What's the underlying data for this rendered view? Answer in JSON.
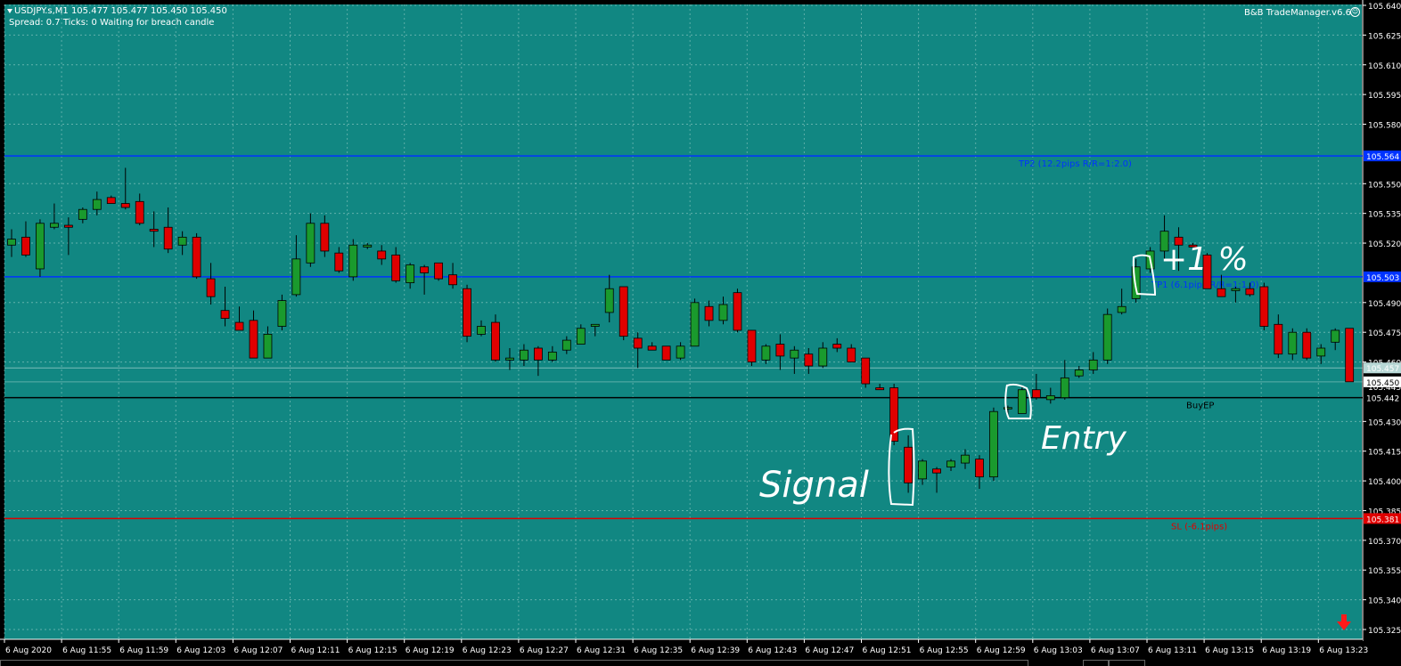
{
  "header": {
    "symbol_line": "USDJPY.s,M1  105.477 105.477 105.450 105.450",
    "status_line": "Spread: 0.7  Ticks: 0  Waiting for breach candle",
    "trade_manager": "B&B TradeManager.v6.6"
  },
  "colors": {
    "background": "#118782",
    "grid": "#a6d6cf",
    "bull": "#1a9a2d",
    "bear": "#e00000",
    "candle_outline": "#000000",
    "tp_line": "#0033ff",
    "ep_line": "#000000",
    "sl_line": "#e00000",
    "annotation": "#ffffff"
  },
  "price_axis": {
    "labels": [
      "105.640",
      "105.625",
      "105.610",
      "105.595",
      "105.580",
      "105.550",
      "105.535",
      "105.520",
      "105.490",
      "105.475",
      "105.460",
      "105.430",
      "105.415",
      "105.400",
      "105.385",
      "105.370",
      "105.355",
      "105.340",
      "105.325"
    ],
    "tags": [
      {
        "name": "tp2-price-tag",
        "text": "105.564",
        "color": "#0033ff",
        "text_color": "#ffffff",
        "price": 105.564
      },
      {
        "name": "tp1-price-tag",
        "text": "105.503",
        "color": "#0033ff",
        "text_color": "#ffffff",
        "price": 105.503
      },
      {
        "name": "ask-price-tag",
        "text": "105.457",
        "color": "#b8d8d6",
        "text_color": "#ffffff",
        "price": 105.457
      },
      {
        "name": "bid-price-tag",
        "text": "105.450",
        "color": "#ffffff",
        "text_color": "#000000",
        "price": 105.45
      },
      {
        "name": "ep-price-tag",
        "text": "105.442",
        "color": "#000000",
        "text_color": "#ffffff",
        "price": 105.442
      },
      {
        "name": "sl-price-tag",
        "text": "105.381",
        "color": "#e00000",
        "text_color": "#ffffff",
        "price": 105.381
      }
    ],
    "partial_label": "105.445"
  },
  "time_axis": {
    "labels": [
      "6 Aug 2020",
      "6 Aug 11:55",
      "6 Aug 11:59",
      "6 Aug 12:03",
      "6 Aug 12:07",
      "6 Aug 12:11",
      "6 Aug 12:15",
      "6 Aug 12:19",
      "6 Aug 12:23",
      "6 Aug 12:27",
      "6 Aug 12:31",
      "6 Aug 12:35",
      "6 Aug 12:39",
      "6 Aug 12:43",
      "6 Aug 12:47",
      "6 Aug 12:51",
      "6 Aug 12:55",
      "6 Aug 12:59",
      "6 Aug 13:03",
      "6 Aug 13:07",
      "6 Aug 13:11",
      "6 Aug 13:15",
      "6 Aug 13:19",
      "6 Aug 13:23"
    ]
  },
  "levels": [
    {
      "name": "tp2-line",
      "price": 105.564,
      "color": "#0033ff",
      "label": "TP2 (12.2pips R/R=1:2.0)"
    },
    {
      "name": "tp1-line",
      "price": 105.503,
      "color": "#0033ff",
      "label": "TP1 (6.1pips R/R=1:1.0)"
    },
    {
      "name": "ep-line",
      "price": 105.442,
      "color": "#000000",
      "label": "BuyEP"
    },
    {
      "name": "sl-line",
      "price": 105.381,
      "color": "#e00000",
      "label": "SL (-6.1pips)"
    }
  ],
  "annotations": {
    "signal": "Signal",
    "entry": "Entry",
    "profit": "+1 %"
  },
  "chart_data": {
    "type": "candlestick",
    "symbol": "USDJPY.s",
    "timeframe": "M1",
    "candles": [
      {
        "o": 105.519,
        "h": 105.527,
        "l": 105.513,
        "c": 105.522
      },
      {
        "o": 105.523,
        "h": 105.531,
        "l": 105.513,
        "c": 105.514
      },
      {
        "o": 105.507,
        "h": 105.532,
        "l": 105.503,
        "c": 105.53
      },
      {
        "o": 105.528,
        "h": 105.54,
        "l": 105.527,
        "c": 105.53
      },
      {
        "o": 105.529,
        "h": 105.533,
        "l": 105.514,
        "c": 105.528
      },
      {
        "o": 105.532,
        "h": 105.538,
        "l": 105.53,
        "c": 105.537
      },
      {
        "o": 105.537,
        "h": 105.546,
        "l": 105.534,
        "c": 105.542
      },
      {
        "o": 105.543,
        "h": 105.544,
        "l": 105.54,
        "c": 105.54
      },
      {
        "o": 105.54,
        "h": 105.558,
        "l": 105.537,
        "c": 105.538
      },
      {
        "o": 105.541,
        "h": 105.545,
        "l": 105.529,
        "c": 105.53
      },
      {
        "o": 105.527,
        "h": 105.536,
        "l": 105.518,
        "c": 105.526
      },
      {
        "o": 105.528,
        "h": 105.538,
        "l": 105.515,
        "c": 105.517
      },
      {
        "o": 105.519,
        "h": 105.526,
        "l": 105.514,
        "c": 105.523
      },
      {
        "o": 105.523,
        "h": 105.525,
        "l": 105.502,
        "c": 105.503
      },
      {
        "o": 105.502,
        "h": 105.51,
        "l": 105.489,
        "c": 105.493
      },
      {
        "o": 105.486,
        "h": 105.498,
        "l": 105.478,
        "c": 105.482
      },
      {
        "o": 105.48,
        "h": 105.488,
        "l": 105.479,
        "c": 105.476
      },
      {
        "o": 105.481,
        "h": 105.486,
        "l": 105.462,
        "c": 105.462
      },
      {
        "o": 105.462,
        "h": 105.478,
        "l": 105.462,
        "c": 105.474
      },
      {
        "o": 105.478,
        "h": 105.494,
        "l": 105.476,
        "c": 105.491
      },
      {
        "o": 105.494,
        "h": 105.524,
        "l": 105.493,
        "c": 105.512
      },
      {
        "o": 105.51,
        "h": 105.535,
        "l": 105.508,
        "c": 105.53
      },
      {
        "o": 105.53,
        "h": 105.534,
        "l": 105.513,
        "c": 105.516
      },
      {
        "o": 105.515,
        "h": 105.518,
        "l": 105.505,
        "c": 105.506
      },
      {
        "o": 105.503,
        "h": 105.522,
        "l": 105.501,
        "c": 105.519
      },
      {
        "o": 105.518,
        "h": 105.52,
        "l": 105.517,
        "c": 105.519
      },
      {
        "o": 105.516,
        "h": 105.519,
        "l": 105.509,
        "c": 105.512
      },
      {
        "o": 105.514,
        "h": 105.518,
        "l": 105.5,
        "c": 105.501
      },
      {
        "o": 105.5,
        "h": 105.51,
        "l": 105.497,
        "c": 105.509
      },
      {
        "o": 105.508,
        "h": 105.509,
        "l": 105.494,
        "c": 105.505
      },
      {
        "o": 105.51,
        "h": 105.509,
        "l": 105.501,
        "c": 105.502
      },
      {
        "o": 105.504,
        "h": 105.51,
        "l": 105.497,
        "c": 105.499
      },
      {
        "o": 105.497,
        "h": 105.499,
        "l": 105.47,
        "c": 105.473
      },
      {
        "o": 105.474,
        "h": 105.481,
        "l": 105.473,
        "c": 105.478
      },
      {
        "o": 105.48,
        "h": 105.484,
        "l": 105.46,
        "c": 105.461
      },
      {
        "o": 105.461,
        "h": 105.467,
        "l": 105.456,
        "c": 105.462
      },
      {
        "o": 105.461,
        "h": 105.469,
        "l": 105.458,
        "c": 105.466
      },
      {
        "o": 105.467,
        "h": 105.468,
        "l": 105.453,
        "c": 105.461
      },
      {
        "o": 105.461,
        "h": 105.468,
        "l": 105.46,
        "c": 105.465
      },
      {
        "o": 105.466,
        "h": 105.473,
        "l": 105.464,
        "c": 105.471
      },
      {
        "o": 105.469,
        "h": 105.479,
        "l": 105.469,
        "c": 105.477
      },
      {
        "o": 105.478,
        "h": 105.479,
        "l": 105.473,
        "c": 105.479
      },
      {
        "o": 105.485,
        "h": 105.504,
        "l": 105.48,
        "c": 105.497
      },
      {
        "o": 105.498,
        "h": 105.497,
        "l": 105.471,
        "c": 105.473
      },
      {
        "o": 105.472,
        "h": 105.475,
        "l": 105.457,
        "c": 105.467
      },
      {
        "o": 105.468,
        "h": 105.47,
        "l": 105.466,
        "c": 105.466
      },
      {
        "o": 105.468,
        "h": 105.467,
        "l": 105.462,
        "c": 105.461
      },
      {
        "o": 105.462,
        "h": 105.47,
        "l": 105.461,
        "c": 105.468
      },
      {
        "o": 105.468,
        "h": 105.492,
        "l": 105.468,
        "c": 105.49
      },
      {
        "o": 105.488,
        "h": 105.491,
        "l": 105.478,
        "c": 105.481
      },
      {
        "o": 105.481,
        "h": 105.493,
        "l": 105.479,
        "c": 105.489
      },
      {
        "o": 105.495,
        "h": 105.497,
        "l": 105.475,
        "c": 105.476
      },
      {
        "o": 105.476,
        "h": 105.476,
        "l": 105.458,
        "c": 105.46
      },
      {
        "o": 105.461,
        "h": 105.469,
        "l": 105.459,
        "c": 105.468
      },
      {
        "o": 105.469,
        "h": 105.474,
        "l": 105.456,
        "c": 105.463
      },
      {
        "o": 105.462,
        "h": 105.468,
        "l": 105.454,
        "c": 105.466
      },
      {
        "o": 105.464,
        "h": 105.467,
        "l": 105.454,
        "c": 105.458
      },
      {
        "o": 105.458,
        "h": 105.47,
        "l": 105.457,
        "c": 105.467
      },
      {
        "o": 105.469,
        "h": 105.472,
        "l": 105.465,
        "c": 105.467
      },
      {
        "o": 105.467,
        "h": 105.469,
        "l": 105.46,
        "c": 105.46
      },
      {
        "o": 105.462,
        "h": 105.462,
        "l": 105.447,
        "c": 105.449
      },
      {
        "o": 105.447,
        "h": 105.449,
        "l": 105.446,
        "c": 105.446
      },
      {
        "o": 105.447,
        "h": 105.449,
        "l": 105.418,
        "c": 105.42
      },
      {
        "o": 105.417,
        "h": 105.423,
        "l": 105.394,
        "c": 105.399
      },
      {
        "o": 105.401,
        "h": 105.411,
        "l": 105.398,
        "c": 105.41
      },
      {
        "o": 105.406,
        "h": 105.407,
        "l": 105.394,
        "c": 105.404
      },
      {
        "o": 105.407,
        "h": 105.411,
        "l": 105.405,
        "c": 105.41
      },
      {
        "o": 105.409,
        "h": 105.416,
        "l": 105.406,
        "c": 105.413
      },
      {
        "o": 105.411,
        "h": 105.413,
        "l": 105.396,
        "c": 105.402
      },
      {
        "o": 105.402,
        "h": 105.437,
        "l": 105.4,
        "c": 105.435
      },
      {
        "o": 105.437,
        "h": 105.438,
        "l": 105.433,
        "c": 105.437
      },
      {
        "o": 105.434,
        "h": 105.448,
        "l": 105.434,
        "c": 105.446
      },
      {
        "o": 105.446,
        "h": 105.454,
        "l": 105.441,
        "c": 105.442
      },
      {
        "o": 105.441,
        "h": 105.447,
        "l": 105.439,
        "c": 105.443
      },
      {
        "o": 105.442,
        "h": 105.461,
        "l": 105.441,
        "c": 105.452
      },
      {
        "o": 105.453,
        "h": 105.458,
        "l": 105.452,
        "c": 105.456
      },
      {
        "o": 105.456,
        "h": 105.465,
        "l": 105.454,
        "c": 105.461
      },
      {
        "o": 105.461,
        "h": 105.487,
        "l": 105.459,
        "c": 105.484
      },
      {
        "o": 105.485,
        "h": 105.497,
        "l": 105.484,
        "c": 105.488
      },
      {
        "o": 105.492,
        "h": 105.512,
        "l": 105.49,
        "c": 105.508
      },
      {
        "o": 105.507,
        "h": 105.518,
        "l": 105.505,
        "c": 105.516
      },
      {
        "o": 105.516,
        "h": 105.534,
        "l": 105.512,
        "c": 105.526
      },
      {
        "o": 105.523,
        "h": 105.528,
        "l": 105.506,
        "c": 105.519
      },
      {
        "o": 105.519,
        "h": 105.52,
        "l": 105.518,
        "c": 105.518
      },
      {
        "o": 105.514,
        "h": 105.515,
        "l": 105.497,
        "c": 105.497
      },
      {
        "o": 105.497,
        "h": 105.504,
        "l": 105.495,
        "c": 105.493
      },
      {
        "o": 105.496,
        "h": 105.498,
        "l": 105.49,
        "c": 105.497
      },
      {
        "o": 105.497,
        "h": 105.5,
        "l": 105.493,
        "c": 105.494
      },
      {
        "o": 105.498,
        "h": 105.5,
        "l": 105.476,
        "c": 105.478
      },
      {
        "o": 105.479,
        "h": 105.484,
        "l": 105.462,
        "c": 105.464
      },
      {
        "o": 105.464,
        "h": 105.477,
        "l": 105.461,
        "c": 105.475
      },
      {
        "o": 105.475,
        "h": 105.477,
        "l": 105.461,
        "c": 105.462
      },
      {
        "o": 105.463,
        "h": 105.469,
        "l": 105.459,
        "c": 105.467
      },
      {
        "o": 105.47,
        "h": 105.477,
        "l": 105.466,
        "c": 105.476
      },
      {
        "o": 105.477,
        "h": 105.477,
        "l": 105.45,
        "c": 105.45
      }
    ]
  }
}
